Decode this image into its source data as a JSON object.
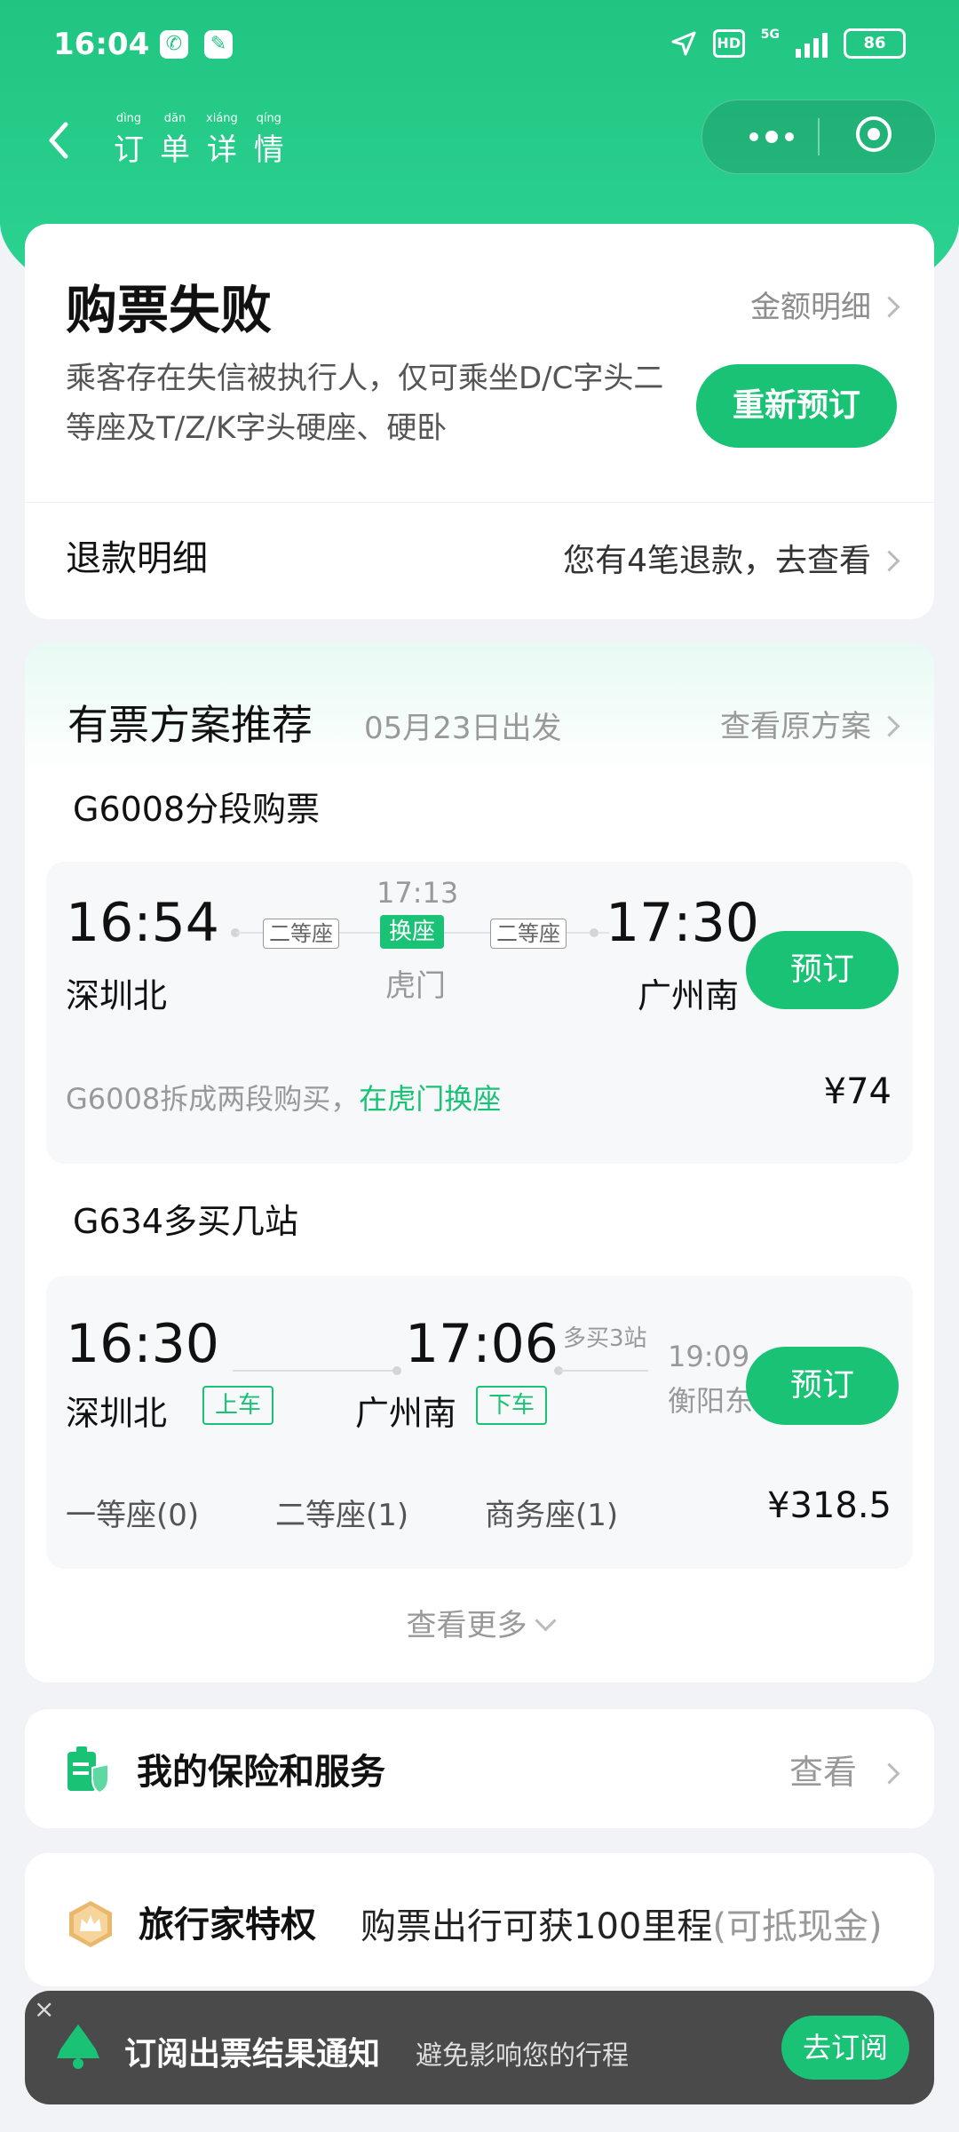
{
  "status_bar": {
    "time": "16:04",
    "hd": "HD",
    "net": "5G",
    "battery": "86"
  },
  "nav": {
    "title_chars": [
      {
        "pinyin": "dìng",
        "hanzi": "订"
      },
      {
        "pinyin": "dān",
        "hanzi": "单"
      },
      {
        "pinyin": "xiáng",
        "hanzi": "详"
      },
      {
        "pinyin": "qíng",
        "hanzi": "情"
      }
    ]
  },
  "result": {
    "title": "购票失败",
    "amount_link": "金额明细",
    "desc": "乘客存在失信被执行人，仅可乘坐D/C字头二等座及T/Z/K字头硬座、硬卧",
    "rebook_button": "重新预订",
    "refund_label": "退款明细",
    "refund_link": "您有4笔退款，去查看"
  },
  "recommend": {
    "title": "有票方案推荐",
    "date": "05月23日出发",
    "link": "查看原方案",
    "plan1": {
      "title": "G6008分段购票",
      "depart_time": "16:54",
      "depart_station": "深圳北",
      "seat_a": "二等座",
      "transfer_time": "17:13",
      "transfer_tag": "换座",
      "transfer_station": "虎门",
      "seat_b": "二等座",
      "arrive_time": "17:30",
      "arrive_station": "广州南",
      "book_button": "预订",
      "note": "G6008拆成两段购买，",
      "note_highlight": "在虎门换座",
      "price": "¥74"
    },
    "plan2": {
      "title": "G634多买几站",
      "depart_time": "16:30",
      "depart_station": "深圳北",
      "board_tag": "上车",
      "arrive_time": "17:06",
      "arrive_station": "广州南",
      "alight_tag": "下车",
      "extra_label": "多买3站",
      "end_time": "19:09",
      "end_station": "衡阳东",
      "book_button": "预订",
      "seats": [
        "一等座(0)",
        "二等座(1)",
        "商务座(1)"
      ],
      "price": "¥318.5"
    },
    "more": "查看更多"
  },
  "insurance": {
    "title": "我的保险和服务",
    "link": "查看"
  },
  "traveler": {
    "title": "旅行家特权",
    "desc": "购票出行可获100里程",
    "paren": "(可抵现金)"
  },
  "toast": {
    "close": "×",
    "title": "订阅出票结果通知",
    "desc": "避免影响您的行程",
    "button": "去订阅"
  },
  "colors": {
    "brand_green": "#19c275",
    "header_green": "#21c582"
  }
}
